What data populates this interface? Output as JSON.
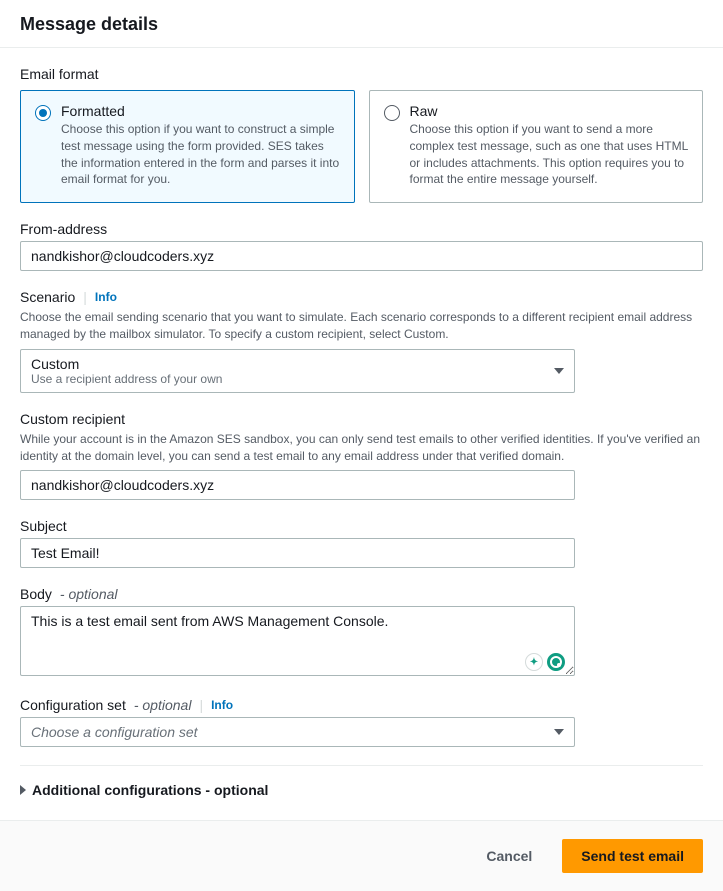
{
  "header": {
    "title": "Message details"
  },
  "emailFormat": {
    "label": "Email format",
    "options": [
      {
        "title": "Formatted",
        "desc": "Choose this option if you want to construct a simple test message using the form provided. SES takes the information entered in the form and parses it into email format for you.",
        "selected": true
      },
      {
        "title": "Raw",
        "desc": "Choose this option if you want to send a more complex test message, such as one that uses HTML or includes attachments. This option requires you to format the entire message yourself.",
        "selected": false
      }
    ]
  },
  "fromAddress": {
    "label": "From-address",
    "value": "nandkishor@cloudcoders.xyz"
  },
  "scenario": {
    "label": "Scenario",
    "info": "Info",
    "help": "Choose the email sending scenario that you want to simulate. Each scenario corresponds to a different recipient email address managed by the mailbox simulator. To specify a custom recipient, select Custom.",
    "selectedTitle": "Custom",
    "selectedSub": "Use a recipient address of your own"
  },
  "customRecipient": {
    "label": "Custom recipient",
    "help": "While your account is in the Amazon SES sandbox, you can only send test emails to other verified identities. If you've verified an identity at the domain level, you can send a test email to any email address under that verified domain.",
    "value": "nandkishor@cloudcoders.xyz"
  },
  "subject": {
    "label": "Subject",
    "value": "Test Email!"
  },
  "body": {
    "label": "Body",
    "optional": " - optional",
    "value": "This is a test email sent from AWS Management Console."
  },
  "configSet": {
    "label": "Configuration set",
    "optional": " - optional",
    "info": "Info",
    "placeholder": "Choose a configuration set"
  },
  "expander": {
    "title": "Additional configurations - optional"
  },
  "footer": {
    "cancel": "Cancel",
    "submit": "Send test email"
  }
}
